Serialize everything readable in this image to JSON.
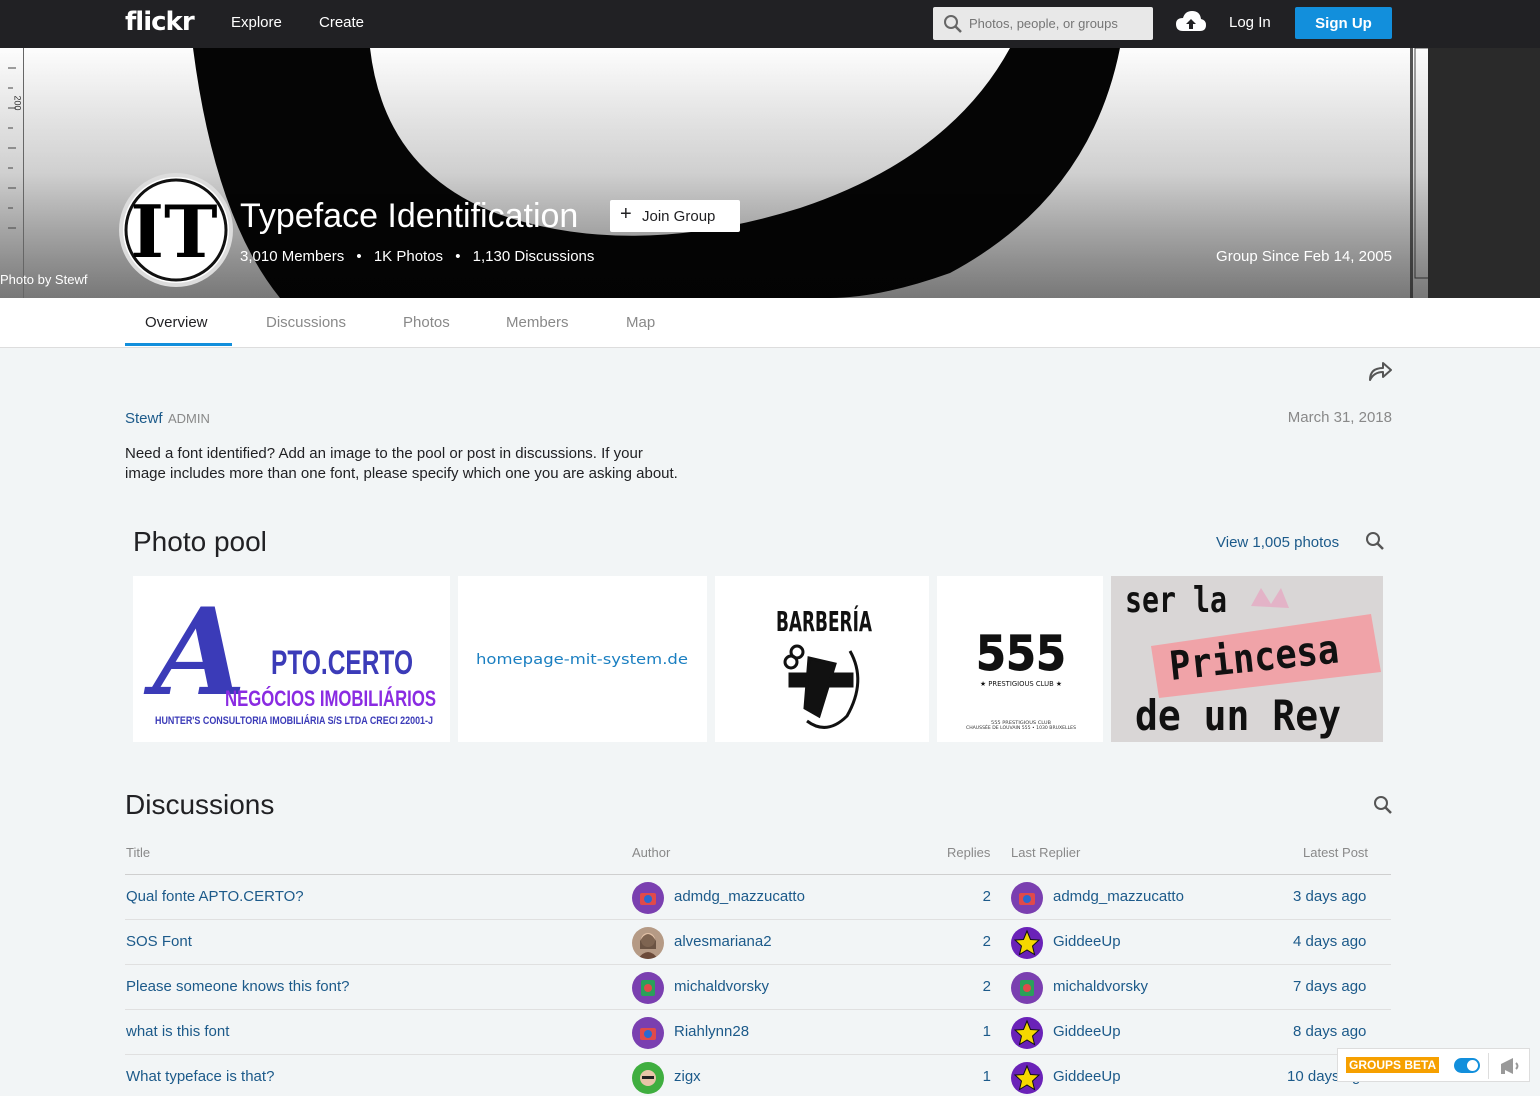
{
  "nav": {
    "logo": "flickr",
    "explore": "Explore",
    "create": "Create",
    "search_placeholder": "Photos, people, or groups",
    "login": "Log In",
    "signup": "Sign Up"
  },
  "cover": {
    "credit": "Photo by Stewf",
    "ruler_label": "200",
    "avatar_text": "IT"
  },
  "group": {
    "title": "Typeface Identification",
    "join": "Join Group",
    "members": "3,010 Members",
    "photos": "1K Photos",
    "discussions": "1,130 Discussions",
    "bullet": "•",
    "since": "Group Since Feb 14, 2005"
  },
  "tabs": [
    "Overview",
    "Discussions",
    "Photos",
    "Members",
    "Map"
  ],
  "about": {
    "admin_name": "Stewf",
    "admin_tag": "ADMIN",
    "date": "March 31, 2018",
    "description": "Need a font identified? Add an image to the pool or post in discussions. If your image includes more than one font, please specify which one you are asking about."
  },
  "pool": {
    "title": "Photo pool",
    "view_link": "View 1,005 photos",
    "tiles": {
      "t1": {
        "big": "A",
        "rest": "PTO.CERTO",
        "line2": "NEGÓCIOS IMOBILIÁRIOS",
        "line3": "HUNTER'S CONSULTORIA IMOBILIÁRIA S/S LTDA   CRECI 22001-J"
      },
      "t2": {
        "text": "homepage-mit-system.de"
      },
      "t3": {
        "text": "BARBERÍA"
      },
      "t4": {
        "number": "555",
        "sub": "★ PRESTIGIOUS CLUB ★",
        "small1": "555 PRESTIGIOUS CLUB",
        "small2": "CHAUSSÉE DE LOUVAIN 555 • 1030 BRUXELLES"
      },
      "t5": {
        "line1": "ser la",
        "line2": "Princesa",
        "line3": "de un Rey"
      }
    }
  },
  "discussions": {
    "title": "Discussions",
    "headers": {
      "title": "Title",
      "author": "Author",
      "replies": "Replies",
      "last_replier": "Last Replier",
      "latest_post": "Latest Post"
    },
    "rows": [
      {
        "title": "Qual fonte APTO.CERTO?",
        "author": "admdg_mazzucatto",
        "replies": "2",
        "last_replier": "admdg_mazzucatto",
        "latest": "3 days ago"
      },
      {
        "title": "SOS Font",
        "author": "alvesmariana2",
        "replies": "2",
        "last_replier": "GiddeeUp",
        "latest": "4 days ago"
      },
      {
        "title": "Please someone knows this font?",
        "author": "michaldvorsky",
        "replies": "2",
        "last_replier": "michaldvorsky",
        "latest": "7 days ago"
      },
      {
        "title": "what is this font",
        "author": "Riahlynn28",
        "replies": "1",
        "last_replier": "GiddeeUp",
        "latest": "8 days ago"
      },
      {
        "title": "What typeface is that?",
        "author": "zigx",
        "replies": "1",
        "last_replier": "GiddeeUp",
        "latest": "10 days ago"
      }
    ]
  },
  "beta": {
    "label": "GROUPS BETA"
  },
  "colors": {
    "accent": "#128fdc",
    "link": "#1c5a8a",
    "nav_bg": "#212124",
    "beta": "#f6a000"
  }
}
